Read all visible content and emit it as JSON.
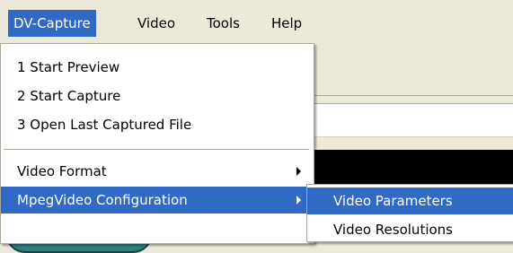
{
  "menubar": {
    "items": [
      {
        "label": "DV-Capture",
        "active": true
      },
      {
        "label": "Video",
        "active": false
      },
      {
        "label": "Tools",
        "active": false
      },
      {
        "label": "Help",
        "active": false
      }
    ]
  },
  "dv_capture_menu": {
    "items": [
      {
        "label": "1 Start Preview"
      },
      {
        "label": "2 Start Capture"
      },
      {
        "label": "3 Open Last Captured  File"
      },
      {
        "label": "Video Format",
        "has_submenu": true
      },
      {
        "label": "MpegVideo Configuration",
        "has_submenu": true,
        "highlighted": true
      }
    ]
  },
  "mpeg_submenu": {
    "items": [
      {
        "label": "Video Parameters",
        "highlighted": true
      },
      {
        "label": "Video Resolutions"
      }
    ]
  },
  "colors": {
    "highlight": "#316ac5",
    "menu_background": "#ffffff",
    "window_background": "#ece9d8"
  }
}
